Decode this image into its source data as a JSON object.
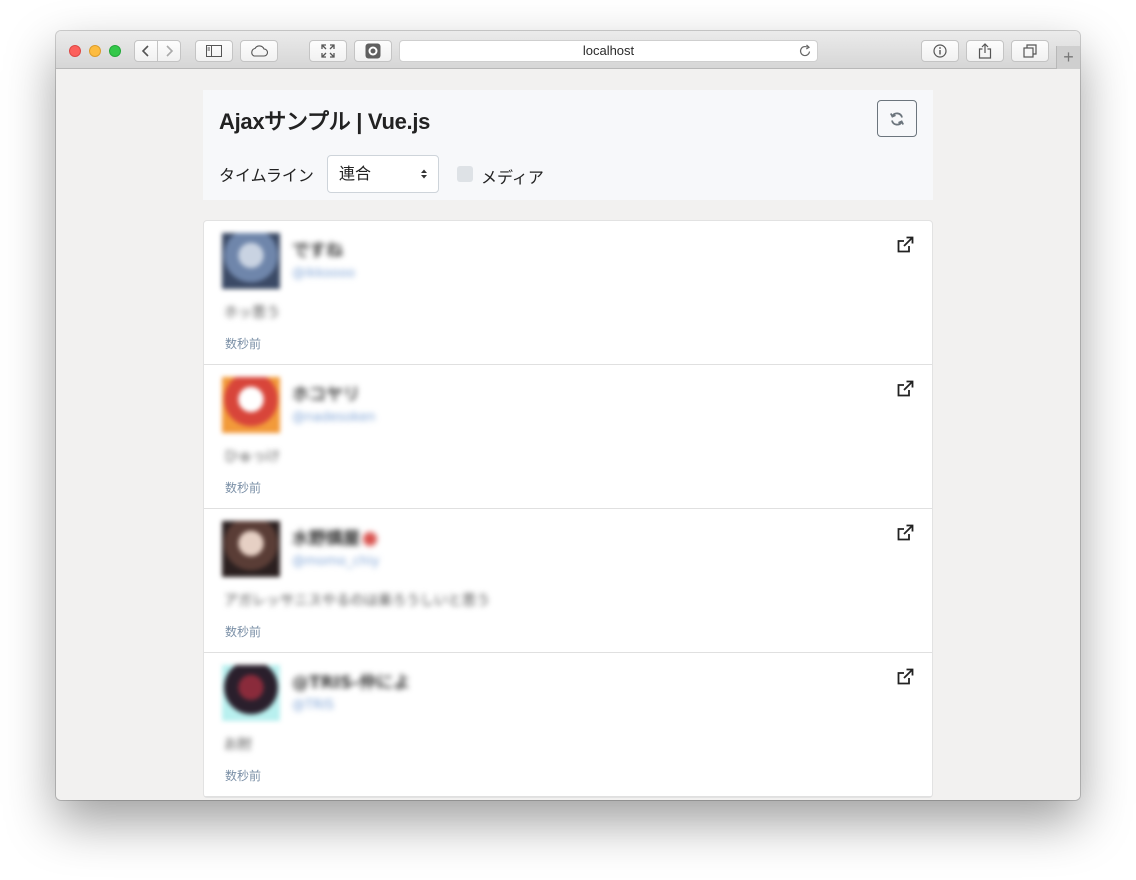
{
  "browser": {
    "url": "localhost",
    "icons": {
      "back": "chevron-left-icon",
      "forward": "chevron-right-icon",
      "sidebar": "sidebar-icon",
      "icloud": "cloud-icon",
      "fullscreen": "expand-icon",
      "extension": "extension-icon",
      "reload": "reload-icon",
      "info": "info-icon",
      "share": "share-icon",
      "tabs": "tabs-icon"
    },
    "new_tab_label": "+"
  },
  "header": {
    "title": "Ajaxサンプル | Vue.js",
    "refresh_icon": "refresh-icon",
    "timeline_label": "タイムライン",
    "timeline_selected": "連合",
    "media_label": "メディア",
    "media_checked": false
  },
  "posts": [
    {
      "name": "ですね",
      "handle": "@ikkoooo",
      "text": "ホッ思う",
      "time": "数秒前",
      "avatar_colors": [
        "#3b4a66",
        "#c9d3e2",
        "#6f86ab"
      ],
      "badge": false
    },
    {
      "name": "ホコヤリ",
      "handle": "@nadesoken",
      "text": "ひゅっけ",
      "time": "数秒前",
      "avatar_colors": [
        "#f29a3a",
        "#ffffff",
        "#d8453a"
      ],
      "badge": false
    },
    {
      "name": "水野燐屋",
      "handle": "@momo_chiy",
      "text": "アガレッサニスやるのは楽ろうしいと思う",
      "time": "数秒前",
      "avatar_colors": [
        "#2b2020",
        "#e6d0c4",
        "#5a3d36"
      ],
      "badge": true
    },
    {
      "name": "@TRIS-仲によ",
      "handle": "@TRIS",
      "text": "お肘",
      "time": "数秒前",
      "avatar_colors": [
        "#b8f0ef",
        "#8a2b3b",
        "#2a1f2c"
      ],
      "badge": false
    }
  ],
  "accent_colors": {
    "time_text": "#7a8fa6",
    "handle_text": "#7fa4d6",
    "header_bg": "#f7f8fa"
  }
}
